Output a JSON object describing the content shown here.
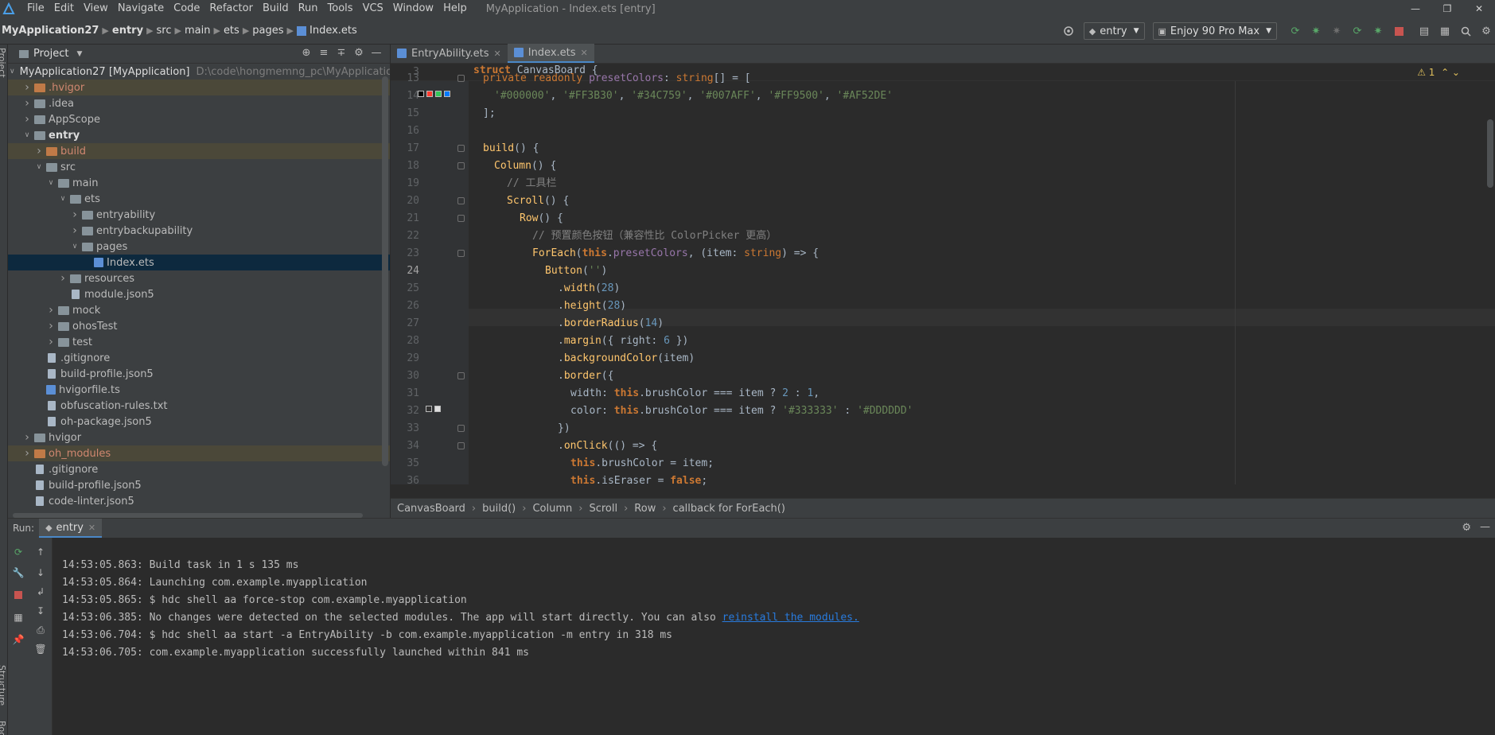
{
  "menu": {
    "items": [
      "File",
      "Edit",
      "View",
      "Navigate",
      "Code",
      "Refactor",
      "Build",
      "Run",
      "Tools",
      "VCS",
      "Window",
      "Help"
    ],
    "window_title": "MyApplication - Index.ets [entry]"
  },
  "nav": {
    "crumbs": [
      "MyApplication27",
      "entry",
      "src",
      "main",
      "ets",
      "pages",
      "Index.ets"
    ],
    "run_config": "entry",
    "device": "Enjoy 90 Pro Max"
  },
  "side": {
    "project_label": "Project",
    "structure_label": "Structure",
    "bookmarks_label": "Bookmarks"
  },
  "project": {
    "title": "Project",
    "tree": [
      {
        "label": "MyApplication27 [MyApplication]",
        "hint": "D:\\code\\hongmemng_pc\\MyApplication",
        "depth": 0,
        "arrow": "open",
        "icon": "folder"
      },
      {
        "label": ".hvigor",
        "depth": 1,
        "arrow": "closed",
        "icon": "folder-o",
        "style": "hl"
      },
      {
        "label": ".idea",
        "depth": 1,
        "arrow": "closed",
        "icon": "folder"
      },
      {
        "label": "AppScope",
        "depth": 1,
        "arrow": "closed",
        "icon": "folder"
      },
      {
        "label": "entry",
        "depth": 1,
        "arrow": "open",
        "icon": "folder",
        "bold": true
      },
      {
        "label": "build",
        "depth": 2,
        "arrow": "closed",
        "icon": "folder-o",
        "style": "hl"
      },
      {
        "label": "src",
        "depth": 2,
        "arrow": "open",
        "icon": "folder"
      },
      {
        "label": "main",
        "depth": 3,
        "arrow": "open",
        "icon": "folder"
      },
      {
        "label": "ets",
        "depth": 4,
        "arrow": "open",
        "icon": "folder"
      },
      {
        "label": "entryability",
        "depth": 5,
        "arrow": "closed",
        "icon": "folder"
      },
      {
        "label": "entrybackupability",
        "depth": 5,
        "arrow": "closed",
        "icon": "folder"
      },
      {
        "label": "pages",
        "depth": 5,
        "arrow": "open",
        "icon": "folder"
      },
      {
        "label": "Index.ets",
        "depth": 6,
        "arrow": "none",
        "icon": "fileblue",
        "style": "sel"
      },
      {
        "label": "resources",
        "depth": 4,
        "arrow": "closed",
        "icon": "folder"
      },
      {
        "label": "module.json5",
        "depth": 4,
        "arrow": "none",
        "icon": "file"
      },
      {
        "label": "mock",
        "depth": 3,
        "arrow": "closed",
        "icon": "folder"
      },
      {
        "label": "ohosTest",
        "depth": 3,
        "arrow": "closed",
        "icon": "folder"
      },
      {
        "label": "test",
        "depth": 3,
        "arrow": "closed",
        "icon": "folder"
      },
      {
        "label": ".gitignore",
        "depth": 2,
        "arrow": "none",
        "icon": "file"
      },
      {
        "label": "build-profile.json5",
        "depth": 2,
        "arrow": "none",
        "icon": "file"
      },
      {
        "label": "hvigorfile.ts",
        "depth": 2,
        "arrow": "none",
        "icon": "fileblue"
      },
      {
        "label": "obfuscation-rules.txt",
        "depth": 2,
        "arrow": "none",
        "icon": "file"
      },
      {
        "label": "oh-package.json5",
        "depth": 2,
        "arrow": "none",
        "icon": "file"
      },
      {
        "label": "hvigor",
        "depth": 1,
        "arrow": "closed",
        "icon": "folder"
      },
      {
        "label": "oh_modules",
        "depth": 1,
        "arrow": "closed",
        "icon": "folder-o",
        "style": "hl"
      },
      {
        "label": ".gitignore",
        "depth": 1,
        "arrow": "none",
        "icon": "file"
      },
      {
        "label": "build-profile.json5",
        "depth": 1,
        "arrow": "none",
        "icon": "file"
      },
      {
        "label": "code-linter.json5",
        "depth": 1,
        "arrow": "none",
        "icon": "file"
      }
    ]
  },
  "editor": {
    "tabs": [
      {
        "label": "EntryAbility.ets",
        "active": false
      },
      {
        "label": "Index.ets",
        "active": true
      }
    ],
    "sticky_line_number": "3",
    "warning_count": "1",
    "lines": [
      {
        "n": "13"
      },
      {
        "n": "14"
      },
      {
        "n": "15"
      },
      {
        "n": "16"
      },
      {
        "n": "17"
      },
      {
        "n": "18"
      },
      {
        "n": "19"
      },
      {
        "n": "20"
      },
      {
        "n": "21"
      },
      {
        "n": "22"
      },
      {
        "n": "23"
      },
      {
        "n": "24"
      },
      {
        "n": "25"
      },
      {
        "n": "26"
      },
      {
        "n": "27"
      },
      {
        "n": "28"
      },
      {
        "n": "29"
      },
      {
        "n": "30"
      },
      {
        "n": "31"
      },
      {
        "n": "32"
      },
      {
        "n": "33"
      },
      {
        "n": "34"
      },
      {
        "n": "35"
      },
      {
        "n": "36"
      }
    ],
    "current_line": "24",
    "swatch_colors": [
      "#000000",
      "#FF3B30",
      "#34C759",
      "#007AFF"
    ],
    "swatch_colors_b": [
      "#333333",
      "#DDDDDD"
    ],
    "breadcrumbs": [
      "CanvasBoard",
      "build()",
      "Column",
      "Scroll",
      "Row",
      "callback for ForEach()"
    ]
  },
  "run": {
    "label": "Run:",
    "tab": "entry",
    "log": [
      {
        "text": "14:53:05.863: Build task in 1 s 135 ms"
      },
      {
        "text": "14:53:05.864: Launching com.example.myapplication"
      },
      {
        "text": "14:53:05.865: $ hdc shell aa force-stop com.example.myapplication"
      },
      {
        "text": "14:53:06.385: No changes were detected on the selected modules. The app will start directly. You can also ",
        "link": "reinstall the modules."
      },
      {
        "text": "14:53:06.704: $ hdc shell aa start -a EntryAbility -b com.example.myapplication -m entry in 318 ms"
      },
      {
        "text": "14:53:06.705: com.example.myapplication successfully launched within 841 ms"
      }
    ]
  }
}
